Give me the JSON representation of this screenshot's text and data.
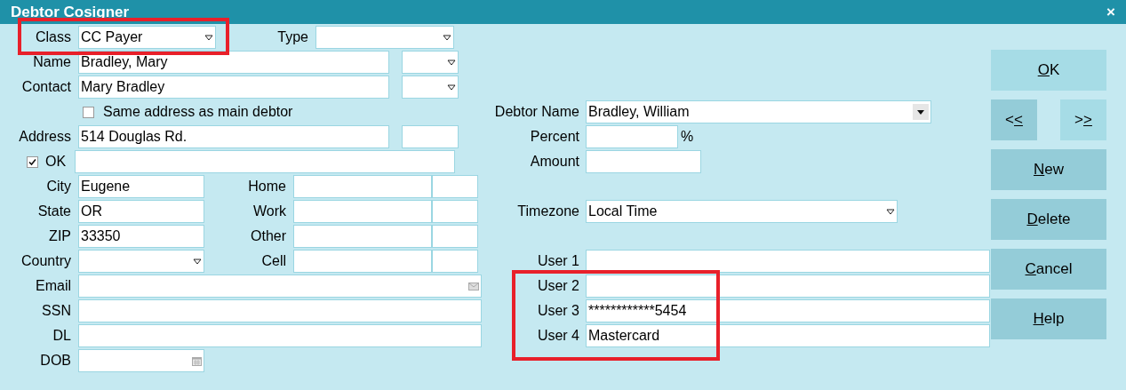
{
  "window": {
    "title": "Debtor Cosigner",
    "close": "×"
  },
  "class": {
    "label": "Class",
    "value": "CC Payer"
  },
  "type": {
    "label": "Type"
  },
  "name": {
    "label": "Name",
    "value": "Bradley, Mary"
  },
  "contact": {
    "label": "Contact",
    "value": "Mary Bradley"
  },
  "same_address": {
    "label": "Same address as main debtor",
    "checked": false
  },
  "address": {
    "label": "Address",
    "value": "514 Douglas Rd."
  },
  "address_ok": {
    "label": "OK",
    "checked": true
  },
  "city": {
    "label": "City",
    "value": "Eugene"
  },
  "state": {
    "label": "State",
    "value": "OR"
  },
  "zip": {
    "label": "ZIP",
    "value": "33350"
  },
  "country": {
    "label": "Country"
  },
  "phones": [
    {
      "label": "Home"
    },
    {
      "label": "Work"
    },
    {
      "label": "Other"
    },
    {
      "label": "Cell"
    }
  ],
  "email": {
    "label": "Email"
  },
  "ssn": {
    "label": "SSN"
  },
  "dl": {
    "label": "DL"
  },
  "dob": {
    "label": "DOB"
  },
  "debtor_name": {
    "label": "Debtor Name",
    "value": "Bradley, William"
  },
  "percent": {
    "label": "Percent",
    "unit": "%"
  },
  "amount": {
    "label": "Amount"
  },
  "timezone": {
    "label": "Timezone",
    "value": "Local Time"
  },
  "user_fields": [
    {
      "label": "User 1"
    },
    {
      "label": "User 2"
    },
    {
      "label": "User 3",
      "value": "************5454"
    },
    {
      "label": "User 4",
      "value": "Mastercard"
    }
  ],
  "buttons": [
    {
      "access_key": "O",
      "after": "K",
      "highlighted": true
    },
    {
      "before": "<",
      "access_key": "<",
      "highlighted": false
    },
    {
      "before": ">",
      "access_key": ">",
      "highlighted": true
    },
    {
      "access_key": "N",
      "after": "ew",
      "highlighted": false
    },
    {
      "access_key": "D",
      "after": "elete",
      "highlighted": false
    },
    {
      "access_key": "C",
      "after": "ancel",
      "highlighted": false
    },
    {
      "access_key": "H",
      "after": "elp",
      "highlighted": false
    }
  ],
  "annotations": [
    {
      "kind": "highlight-box"
    },
    {
      "kind": "highlight-box"
    }
  ]
}
